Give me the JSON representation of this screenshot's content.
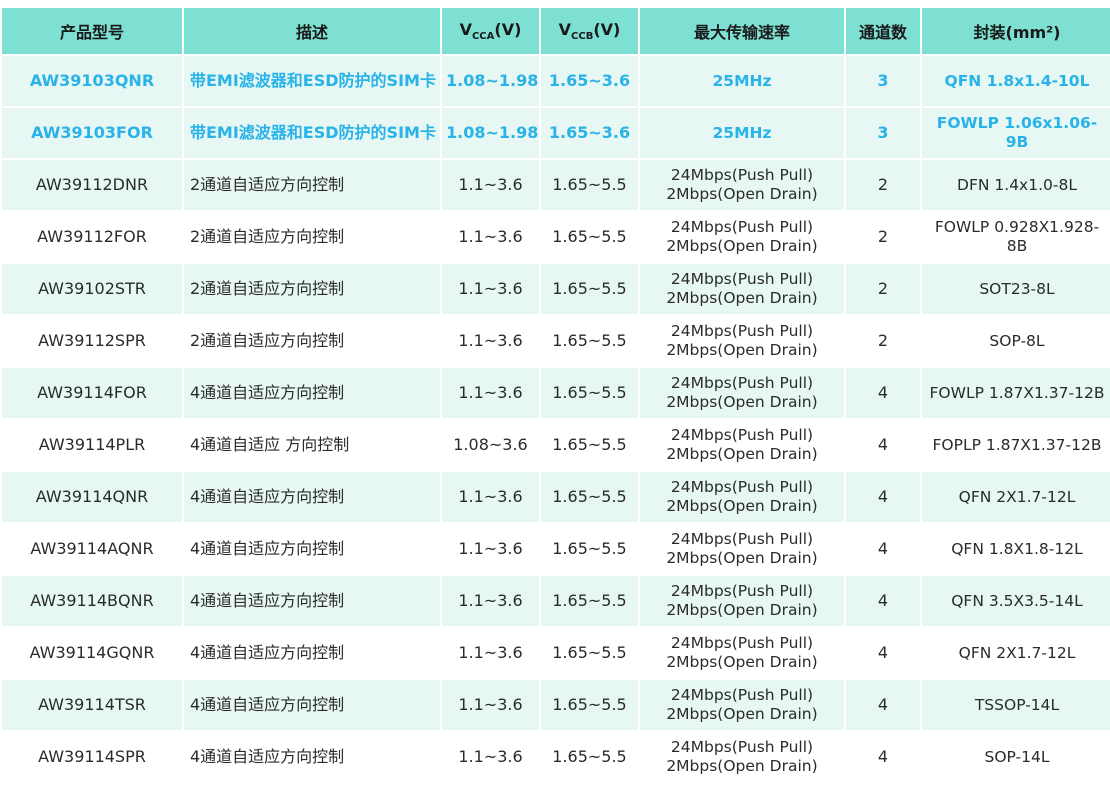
{
  "headers": {
    "model": "产品型号",
    "desc": "描述",
    "vcca_main": "V",
    "vcca_sub": "CCA",
    "vcca_unit": "(V)",
    "vccb_main": "V",
    "vccb_sub": "CCB",
    "vccb_unit": "(V)",
    "rate": "最大传输速率",
    "channels": "通道数",
    "package": "封装(mm²)"
  },
  "rows": [
    {
      "model": "AW39103QNR",
      "desc": "带EMI滤波器和ESD防护的SIM卡",
      "vcca": "1.08~1.98",
      "vccb": "1.65~3.6",
      "rate1": "25MHz",
      "rate2": "",
      "ch": "3",
      "pkg": "QFN 1.8x1.4-10L"
    },
    {
      "model": "AW39103FOR",
      "desc": "带EMI滤波器和ESD防护的SIM卡",
      "vcca": "1.08~1.98",
      "vccb": "1.65~3.6",
      "rate1": "25MHz",
      "rate2": "",
      "ch": "3",
      "pkg": "FOWLP 1.06x1.06-9B"
    },
    {
      "model": "AW39112DNR",
      "desc": "2通道自适应方向控制",
      "vcca": "1.1~3.6",
      "vccb": "1.65~5.5",
      "rate1": "24Mbps(Push Pull)",
      "rate2": "2Mbps(Open Drain)",
      "ch": "2",
      "pkg": "DFN 1.4x1.0-8L"
    },
    {
      "model": "AW39112FOR",
      "desc": "2通道自适应方向控制",
      "vcca": "1.1~3.6",
      "vccb": "1.65~5.5",
      "rate1": "24Mbps(Push Pull)",
      "rate2": "2Mbps(Open Drain)",
      "ch": "2",
      "pkg": "FOWLP 0.928X1.928-8B"
    },
    {
      "model": "AW39102STR",
      "desc": "2通道自适应方向控制",
      "vcca": "1.1~3.6",
      "vccb": "1.65~5.5",
      "rate1": "24Mbps(Push Pull)",
      "rate2": "2Mbps(Open Drain)",
      "ch": "2",
      "pkg": "SOT23-8L"
    },
    {
      "model": "AW39112SPR",
      "desc": "2通道自适应方向控制",
      "vcca": "1.1~3.6",
      "vccb": "1.65~5.5",
      "rate1": "24Mbps(Push Pull)",
      "rate2": "2Mbps(Open Drain)",
      "ch": "2",
      "pkg": "SOP-8L"
    },
    {
      "model": "AW39114FOR",
      "desc": "4通道自适应方向控制",
      "vcca": "1.1~3.6",
      "vccb": "1.65~5.5",
      "rate1": "24Mbps(Push Pull)",
      "rate2": "2Mbps(Open Drain)",
      "ch": "4",
      "pkg": "FOWLP 1.87X1.37-12B"
    },
    {
      "model": "AW39114PLR",
      "desc": "4通道自适应 方向控制",
      "vcca": "1.08~3.6",
      "vccb": "1.65~5.5",
      "rate1": "24Mbps(Push Pull)",
      "rate2": "2Mbps(Open Drain)",
      "ch": "4",
      "pkg": "FOPLP 1.87X1.37-12B"
    },
    {
      "model": "AW39114QNR",
      "desc": "4通道自适应方向控制",
      "vcca": "1.1~3.6",
      "vccb": "1.65~5.5",
      "rate1": "24Mbps(Push Pull)",
      "rate2": "2Mbps(Open Drain)",
      "ch": "4",
      "pkg": "QFN 2X1.7-12L"
    },
    {
      "model": "AW39114AQNR",
      "desc": "4通道自适应方向控制",
      "vcca": "1.1~3.6",
      "vccb": "1.65~5.5",
      "rate1": "24Mbps(Push Pull)",
      "rate2": "2Mbps(Open Drain)",
      "ch": "4",
      "pkg": "QFN 1.8X1.8-12L"
    },
    {
      "model": "AW39114BQNR",
      "desc": "4通道自适应方向控制",
      "vcca": "1.1~3.6",
      "vccb": "1.65~5.5",
      "rate1": "24Mbps(Push Pull)",
      "rate2": "2Mbps(Open Drain)",
      "ch": "4",
      "pkg": "QFN 3.5X3.5-14L"
    },
    {
      "model": "AW39114GQNR",
      "desc": "4通道自适应方向控制",
      "vcca": "1.1~3.6",
      "vccb": "1.65~5.5",
      "rate1": "24Mbps(Push Pull)",
      "rate2": "2Mbps(Open Drain)",
      "ch": "4",
      "pkg": "QFN 2X1.7-12L"
    },
    {
      "model": "AW39114TSR",
      "desc": "4通道自适应方向控制",
      "vcca": "1.1~3.6",
      "vccb": "1.65~5.5",
      "rate1": "24Mbps(Push Pull)",
      "rate2": "2Mbps(Open Drain)",
      "ch": "4",
      "pkg": "TSSOP-14L"
    },
    {
      "model": "AW39114SPR",
      "desc": "4通道自适应方向控制",
      "vcca": "1.1~3.6",
      "vccb": "1.65~5.5",
      "rate1": "24Mbps(Push Pull)",
      "rate2": "2Mbps(Open Drain)",
      "ch": "4",
      "pkg": "SOP-14L"
    }
  ],
  "colors": {
    "header_bg": "#7de0d2",
    "row_tint": "#e6f7f4",
    "highlight_text": "#29b3e8"
  }
}
